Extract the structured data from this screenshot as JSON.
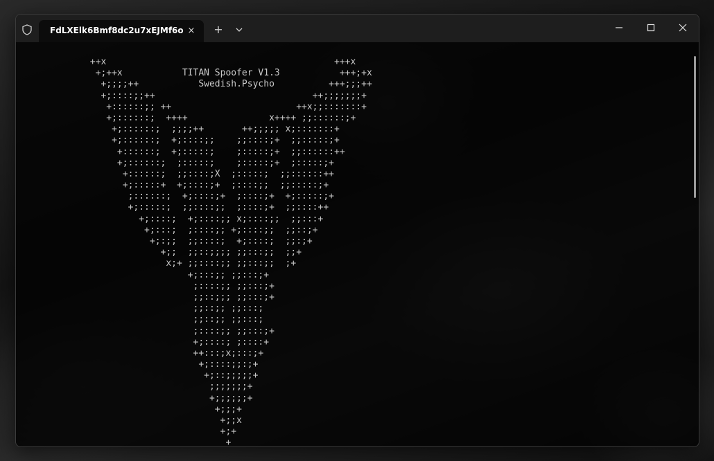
{
  "window": {
    "tab_title": "FdLXElk6Bmf8dc2u7xEJMf6o",
    "tab_close_icon": "×",
    "new_tab_icon": "+",
    "dropdown_icon": "chevron-down-icon"
  },
  "terminal": {
    "lines": [
      {
        "indent": 7,
        "text": "++x                                          +++x"
      },
      {
        "indent": 8,
        "text": "+;++x           TITAN Spoofer V1.3           +++;+x"
      },
      {
        "indent": 9,
        "text": "+;;;;++           Swedish.Psycho          +++;;;++"
      },
      {
        "indent": 9,
        "text": "+;::::;;++                             ++;;;;;;;+"
      },
      {
        "indent": 10,
        "text": "+::::::;; ++                       ++x;;:::::::+"
      },
      {
        "indent": 10,
        "text": "+;::::::;  ++++               x++++ ;;::::::;+"
      },
      {
        "indent": 11,
        "text": "+;::::::;  ;;;;++       ++;;;;; x;:::::::+"
      },
      {
        "indent": 11,
        "text": "+;::::::;  +;::::;;    ;;::::;+  ;;:::::;+"
      },
      {
        "indent": 12,
        "text": "+::::::;  +;:::::;    ;:::::;+  ;;::::::++"
      },
      {
        "indent": 12,
        "text": "+;::::::;  ;:::::;    ;:::::;+  ;:::::;+"
      },
      {
        "indent": 13,
        "text": "+::::::;  ;;::::;X  ;:::::;  ;;::::::++"
      },
      {
        "indent": 13,
        "text": "+;:::::+  +;::::;+  ;::::;;  ;;:::::;+"
      },
      {
        "indent": 14,
        "text": ";::::::;  +;::::;+  ;::::;+  +;:::::;+"
      },
      {
        "indent": 14,
        "text": "+;:::::;  ;;::::;;  ;::::;+  ;;::::++"
      },
      {
        "indent": 16,
        "text": "+;::::;  +;::::;; x;::::;;  ;;:::+"
      },
      {
        "indent": 17,
        "text": "+;:::;  ;::::;; +;::::;;  ;;::;+"
      },
      {
        "indent": 18,
        "text": "+;:;;  ;;::::;  +;::::;  ;;:;+"
      },
      {
        "indent": 20,
        "text": "+;;  ;;::;;;; ;;:::;;  ;;+"
      },
      {
        "indent": 21,
        "text": "x;+ ;;::::;; ;;:::;;  ;+"
      },
      {
        "indent": 25,
        "text": "+;:::;; ;;:::;+"
      },
      {
        "indent": 26,
        "text": ";::::;; ;;:::;+"
      },
      {
        "indent": 26,
        "text": ";;::;;; ;;:::;+"
      },
      {
        "indent": 26,
        "text": ";;::;; ;;:::;"
      },
      {
        "indent": 26,
        "text": ";;::;; ;;:::;"
      },
      {
        "indent": 26,
        "text": ";::::;; ;;:::;+"
      },
      {
        "indent": 26,
        "text": "+;::::; ;::::+"
      },
      {
        "indent": 26,
        "text": "++:::;x;:::;+"
      },
      {
        "indent": 27,
        "text": "+;::::;;:;+"
      },
      {
        "indent": 28,
        "text": "+;::;;;;;+"
      },
      {
        "indent": 29,
        "text": ";;;;;;;+"
      },
      {
        "indent": 29,
        "text": "+;;;;;;+"
      },
      {
        "indent": 30,
        "text": "+;;;+"
      },
      {
        "indent": 31,
        "text": "+;;x"
      },
      {
        "indent": 31,
        "text": "+;+"
      },
      {
        "indent": 32,
        "text": "+"
      }
    ]
  }
}
